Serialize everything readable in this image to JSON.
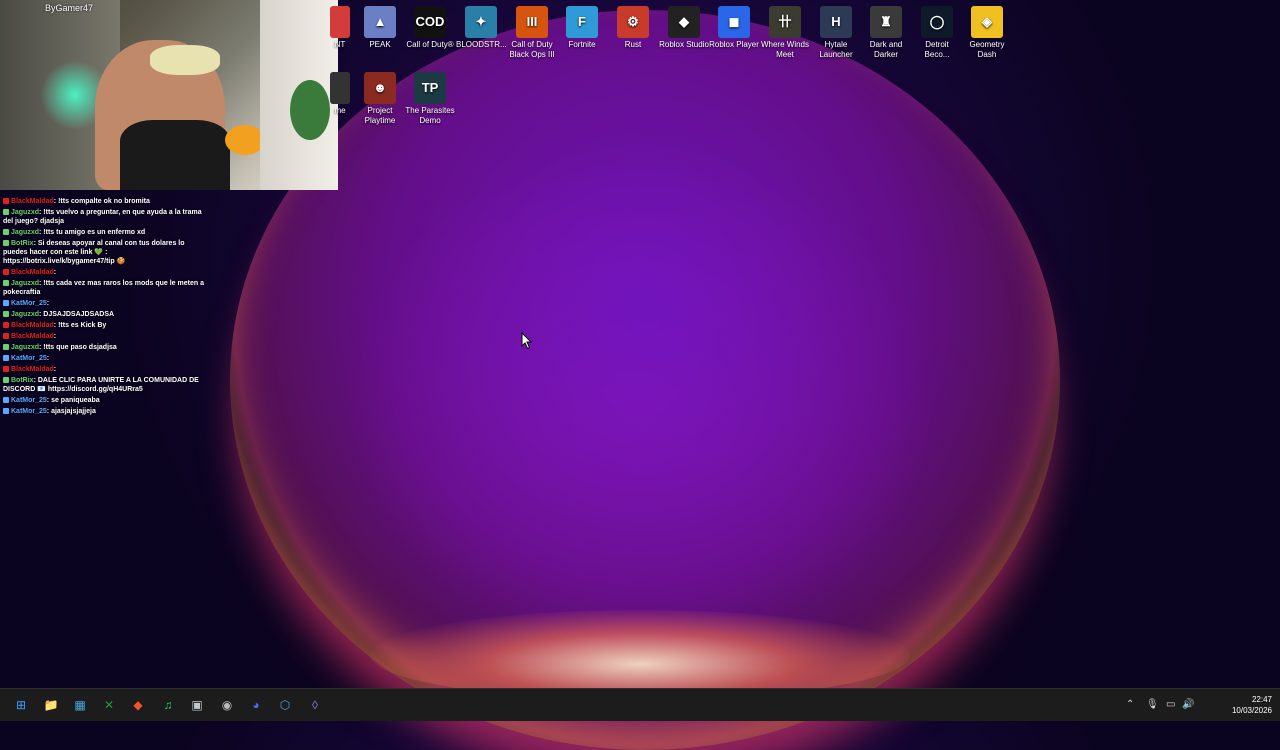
{
  "colors": {
    "taskbar_bg": "#1c1c1c",
    "chat_name_red": "#e02020",
    "chat_name_green": "#6bd16b",
    "chat_name_blue": "#5aa9ff"
  },
  "webcam": {
    "overlay_text": "ByGamer47"
  },
  "chat": {
    "messages": [
      {
        "user": "BlackMaldad",
        "user_color": "#e02020",
        "text": ": !tts compalte ok no bromita"
      },
      {
        "user": "Jaguzxd",
        "user_color": "#6bd16b",
        "text": ": !tts vuelvo a preguntar, en que ayuda a la trama del juego? djadsja"
      },
      {
        "user": "Jaguzxd",
        "user_color": "#6bd16b",
        "text": ": !tts tu amigo es un enfermo xd"
      },
      {
        "user": "BotRix",
        "user_color": "#6bd16b",
        "text": ": Si deseas apoyar al canal con tus dolares lo puedes hacer con este link 💚 : https://botrix.live/k/bygamer47/tip 🍪"
      },
      {
        "user": "BlackMaldad",
        "user_color": "#e02020",
        "text": ":"
      },
      {
        "user": "Jaguzxd",
        "user_color": "#6bd16b",
        "text": ": !tts cada vez mas raros los mods que le meten a pokecraftia"
      },
      {
        "user": "KatMor_25",
        "user_color": "#5aa9ff",
        "text": ":"
      },
      {
        "user": "Jaguzxd",
        "user_color": "#6bd16b",
        "text": ": DJSAJDSAJDSADSA"
      },
      {
        "user": "BlackMaldad",
        "user_color": "#e02020",
        "text": ": !tts es Kick By"
      },
      {
        "user": "BlackMaldad",
        "user_color": "#e02020",
        "text": ":"
      },
      {
        "user": "Jaguzxd",
        "user_color": "#6bd16b",
        "text": ": !tts que paso dsjadjsa"
      },
      {
        "user": "KatMor_25",
        "user_color": "#5aa9ff",
        "text": ":"
      },
      {
        "user": "BlackMaldad",
        "user_color": "#e02020",
        "text": ":"
      },
      {
        "user": "BotRix",
        "user_color": "#6bd16b",
        "text": ": DALE CLIC PARA UNIRTE A LA COMUNIDAD DE DISCORD 📧 https://discord.gg/qH4URra5"
      },
      {
        "user": "KatMor_25",
        "user_color": "#5aa9ff",
        "text": ": se paniqueaba"
      },
      {
        "user": "KatMor_25",
        "user_color": "#5aa9ff",
        "text": ": ajasjajsjajjeja"
      }
    ]
  },
  "desktop": {
    "icons": [
      {
        "label": "NT",
        "icon": "valorant-icon",
        "color": "#d43c3c",
        "glyph": ""
      },
      {
        "label": "PEAK",
        "icon": "peak-icon",
        "color": "#6b7fc4",
        "glyph": "▲"
      },
      {
        "label": "Call of Duty®",
        "icon": "call-of-duty-icon",
        "color": "#111111",
        "glyph": "COD"
      },
      {
        "label": "BLOODSTR...",
        "icon": "bloodstrike-icon",
        "color": "#2a7fa8",
        "glyph": "✦"
      },
      {
        "label": "Call of Duty Black Ops III",
        "icon": "black-ops-icon",
        "color": "#d7540f",
        "glyph": "III"
      },
      {
        "label": "Fortnite",
        "icon": "fortnite-icon",
        "color": "#2f9ad8",
        "glyph": "F"
      },
      {
        "label": "Rust",
        "icon": "rust-icon",
        "color": "#c83a2a",
        "glyph": "⚙"
      },
      {
        "label": "Roblox Studio",
        "icon": "roblox-studio-icon",
        "color": "#222222",
        "glyph": "◆"
      },
      {
        "label": "Roblox Player",
        "icon": "roblox-player-icon",
        "color": "#2a66e8",
        "glyph": "◼"
      },
      {
        "label": "Where Winds Meet",
        "icon": "where-winds-meet-icon",
        "color": "#3b3b30",
        "glyph": "卄"
      },
      {
        "label": "Hytale Launcher",
        "icon": "hytale-icon",
        "color": "#2c3a55",
        "glyph": "H"
      },
      {
        "label": "Dark and Darker",
        "icon": "dark-and-darker-icon",
        "color": "#3a3a3a",
        "glyph": "♜"
      },
      {
        "label": "Detroit Beco...",
        "icon": "detroit-icon",
        "color": "#0e1a2a",
        "glyph": "◯"
      },
      {
        "label": "Geometry Dash",
        "icon": "geometry-dash-icon",
        "color": "#f0c020",
        "glyph": "◈"
      },
      {
        "label": "Project Playtime",
        "icon": "project-playtime-icon",
        "color": "#8a2a20",
        "glyph": "☻"
      },
      {
        "label": "The Parasites Demo",
        "icon": "parasites-icon",
        "color": "#1c3a44",
        "glyph": "TP"
      },
      {
        "label": "me",
        "icon": "partial-icon",
        "color": "#333333",
        "glyph": ""
      }
    ]
  },
  "taskbar": {
    "apps": [
      {
        "name": "start-button",
        "glyph": "⊞",
        "color": "#3aa0ff"
      },
      {
        "name": "file-explorer-icon",
        "glyph": "📁",
        "color": "#f4c542"
      },
      {
        "name": "photos-icon",
        "glyph": "▦",
        "color": "#4aa8e0"
      },
      {
        "name": "xbox-icon",
        "glyph": "✕",
        "color": "#1f9e3a"
      },
      {
        "name": "brave-icon",
        "glyph": "◆",
        "color": "#f2532b"
      },
      {
        "name": "spotify-icon",
        "glyph": "♫",
        "color": "#1ed760"
      },
      {
        "name": "app-icon",
        "glyph": "▣",
        "color": "#c0c8d0"
      },
      {
        "name": "obs-icon",
        "glyph": "◉",
        "color": "#bbbbbb"
      },
      {
        "name": "discord-icon",
        "glyph": "◕",
        "color": "#5865f2"
      },
      {
        "name": "steam-icon",
        "glyph": "⬡",
        "color": "#4fa0d8"
      },
      {
        "name": "launcher-icon",
        "glyph": "◊",
        "color": "#9a7ae8"
      }
    ],
    "tray": {
      "chevron": "⌃",
      "mic": "🎙",
      "display": "▭",
      "volume": "🔊",
      "time": "22:47",
      "date": "10/03/2026"
    }
  }
}
